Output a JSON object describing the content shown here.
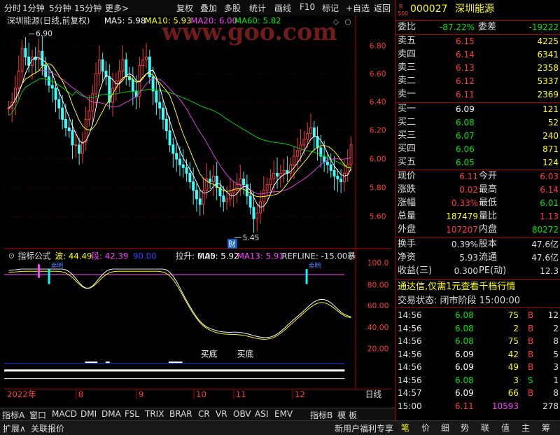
{
  "toolbar": {
    "items": [
      "分时",
      "1分钟",
      "5分钟",
      "15分钟",
      "更多>",
      "复权",
      "叠加",
      "多股",
      "统计",
      "画线",
      "F10",
      "标记",
      "+自选",
      "返回"
    ]
  },
  "chart_title": "深圳能源(日线,前复权)",
  "ma": {
    "ma5": "MA5: 5.98",
    "ma10": "MA10: 5.93",
    "ma20": "MA20: 6.00",
    "ma60": "MA60: 5.82"
  },
  "price_labels": [
    "6.80",
    "6.60",
    "6.40",
    "6.20",
    "6.00",
    "5.80",
    "5.60"
  ],
  "high_label": "6.90",
  "low_label": "5.45",
  "cai_label": "财",
  "watermark": "www.goo.com",
  "indicator": {
    "title": "指标公式",
    "bo": "波: 44.49",
    "duan": "段: 42.39",
    "v90": "90.00",
    "lasheng": "拉升: 0.00",
    "ma5": "MA5: 5.92",
    "ma13": "MA13: 5.91",
    "refline": "REFLINE: -15.00",
    "bao": "暴",
    "scale": [
      "100.0",
      "80.00",
      "60.00",
      "40.00",
      "20.00"
    ],
    "sell": "卖明",
    "buy1": "买底",
    "buy2": "买底"
  },
  "x_labels": [
    "2022年",
    "8",
    "9",
    "10",
    "11",
    "12"
  ],
  "period": "日线",
  "tabs": [
    "指标A",
    "窗口",
    "MACD",
    "DMI",
    "DMA",
    "FSL",
    "TRIX",
    "BRAR",
    "CR",
    "VR",
    "OBV",
    "ASI",
    "EMV",
    "指标B",
    "模",
    "板"
  ],
  "stock": {
    "code": "000027",
    "name": "深圳能源",
    "r": "R",
    "num": "500"
  },
  "weibi": {
    "label": "委比",
    "value": "-87.22%",
    "label2": "委差",
    "value2": "-19222"
  },
  "asks": [
    {
      "label": "卖五",
      "price": "6.15",
      "vol": "4225"
    },
    {
      "label": "卖四",
      "price": "6.14",
      "vol": "6341"
    },
    {
      "label": "卖三",
      "price": "6.13",
      "vol": "2358"
    },
    {
      "label": "卖二",
      "price": "6.12",
      "vol": "5337"
    },
    {
      "label": "卖一",
      "price": "6.11",
      "vol": "2369"
    }
  ],
  "bids": [
    {
      "label": "买一",
      "price": "6.09",
      "vol": "121"
    },
    {
      "label": "买二",
      "price": "6.08",
      "vol": "52"
    },
    {
      "label": "买三",
      "price": "6.07",
      "vol": "240"
    },
    {
      "label": "买四",
      "price": "6.06",
      "vol": "871"
    },
    {
      "label": "买五",
      "price": "6.05",
      "vol": "124"
    }
  ],
  "quote": [
    {
      "l1": "现价",
      "v1": "6.11",
      "l2": "今开",
      "v2": "6.03"
    },
    {
      "l1": "涨跌",
      "v1": "0.02",
      "l2": "最高",
      "v2": "6.14"
    },
    {
      "l1": "涨幅",
      "v1": "0.33%",
      "l2": "最低",
      "v2": "6.01"
    },
    {
      "l1": "总量",
      "v1": "187479",
      "l2": "量比",
      "v2": "1.13"
    },
    {
      "l1": "外盘",
      "v1": "107207",
      "l2": "内盘",
      "v2": "80272"
    }
  ],
  "finance": [
    {
      "l1": "换手",
      "v1": "0.39%",
      "l2": "股本",
      "v2": "47.6亿"
    },
    {
      "l1": "净资",
      "v1": "5.93",
      "l2": "流通",
      "v2": "47.6亿"
    },
    {
      "l1": "收益(三)",
      "v1": "0.300",
      "l2": "PE(动)",
      "v2": "12.3"
    }
  ],
  "ad": "通达信,仅需1元查看千档行情",
  "trade_status": "交易状态: 闭市阶段 15:00:00",
  "ticks": [
    {
      "t": "14:56",
      "p": "6.08",
      "v": "75",
      "d": "B",
      "n": "12"
    },
    {
      "t": "14:56",
      "p": "6.08",
      "v": "2",
      "d": "B",
      "n": "2"
    },
    {
      "t": "14:56",
      "p": "6.08",
      "v": "75",
      "d": "B",
      "n": "8"
    },
    {
      "t": "14:56",
      "p": "6.09",
      "v": "42",
      "d": "B",
      "n": "5"
    },
    {
      "t": "14:56",
      "p": "6.09",
      "v": "49",
      "d": "B",
      "n": "3"
    },
    {
      "t": "14:56",
      "p": "6.08",
      "v": "3",
      "d": "S",
      "n": "1"
    },
    {
      "t": "14:57",
      "p": "6.09",
      "v": "66",
      "d": "B",
      "n": "8"
    },
    {
      "t": "15:00",
      "p": "6.11",
      "v": "10593",
      "d": "",
      "n": "278"
    }
  ],
  "status_bar": {
    "left1": "扩展∧",
    "left2": "关联报价",
    "center": "新用户福利专享"
  },
  "right_tabs": [
    "笔",
    "价",
    "细",
    "势",
    "联",
    "值",
    "主",
    "筹"
  ]
}
